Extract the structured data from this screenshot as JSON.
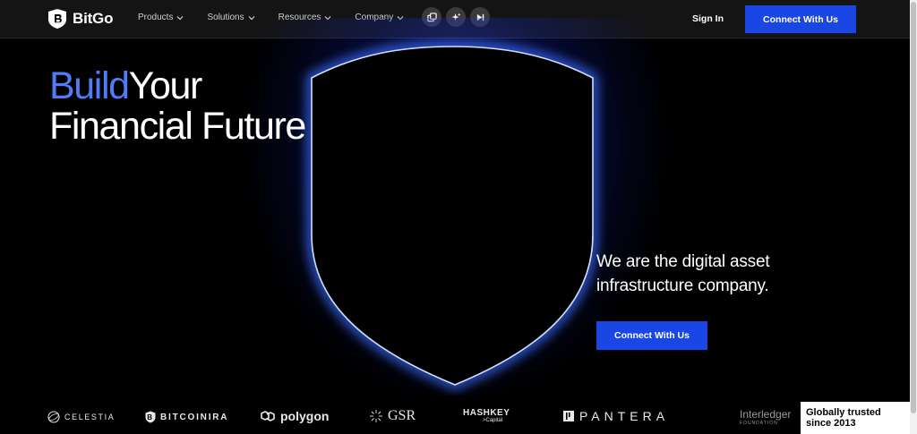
{
  "header": {
    "logo_text": "BitGo",
    "nav": [
      {
        "label": "Products"
      },
      {
        "label": "Solutions"
      },
      {
        "label": "Resources"
      },
      {
        "label": "Company"
      }
    ],
    "tools": [
      "copy-icon",
      "sparkle-icon",
      "skip-forward-icon"
    ],
    "sign_in": "Sign In",
    "cta": "Connect With Us"
  },
  "hero": {
    "headline_accent": "Build",
    "headline_rest_1": "Your",
    "headline_line_2": "Financial Future",
    "subline_1": "We are the digital asset",
    "subline_2": "infrastructure company.",
    "cta": "Connect With Us"
  },
  "partners": {
    "celestia": "CELESTIA",
    "bitcoinira": "BITCOINIRA",
    "polygon": "polygon",
    "gsr": "GSR",
    "hashkey": "HASHKEY",
    "hashkey_sub": ">Capital",
    "pantera": "PANTERA",
    "interledger": "Interledger",
    "interledger_sub": "FOUNDATION"
  },
  "badge": {
    "line_1": "Globally trusted",
    "line_2": "since 2013"
  },
  "colors": {
    "accent": "#4f7df9",
    "button": "#1a46e6",
    "background": "#000000"
  }
}
